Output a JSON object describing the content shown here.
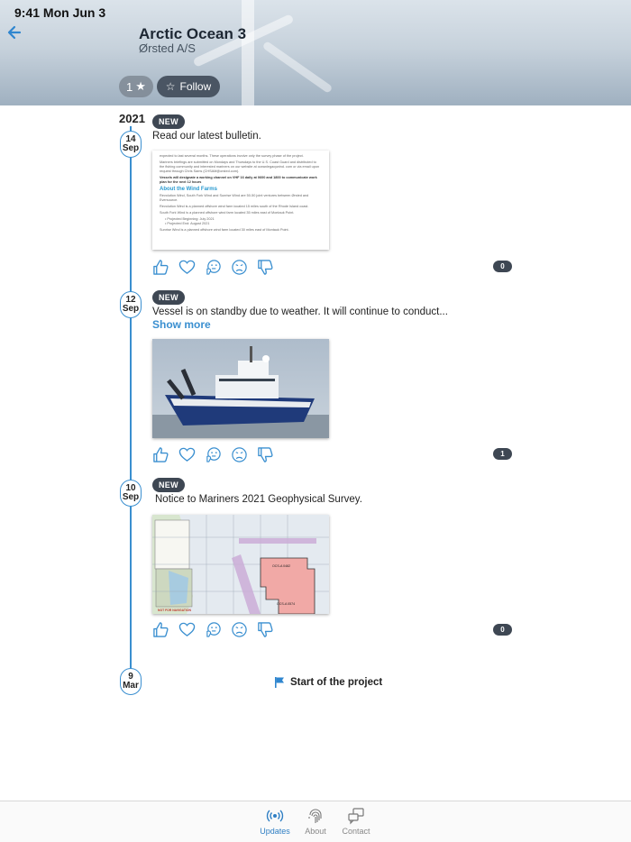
{
  "status_bar": {
    "time": "9:41  Mon Jun 3"
  },
  "header": {
    "title": "Arctic Ocean 3",
    "subtitle": "Ørsted A/S",
    "rating": "1",
    "follow_label": "Follow"
  },
  "timeline": {
    "year": "2021",
    "posts": [
      {
        "day": "14",
        "month": "Sep",
        "badge": "NEW",
        "text": "Read our latest bulletin.",
        "count": "0",
        "bulletin": {
          "line1": "expected to last several months. These operations involve only the survey phase of the project.",
          "line2": "Mariners briefings are submitted on Mondays and Thursdays to the U.S. Coast Guard and distributed to the fishing community and interested mariners on our website at oceanlegacywind. com or via email upon request through Chris Sams (CHSAM@orsted.com).",
          "line3": "Vessels will designate a working channel on VHF 16 daily at 0600 and 1800 to communicate work plan for the next 12 hours",
          "heading": "About the Wind Farms",
          "line4": "Revolution Wind, South Fork Wind and Sunrise Wind are 50-50 joint ventures between Ørsted and Eversource.",
          "line5": "Revolution Wind is a planned offshore wind farm located 15 miles south of the Rhode Island coast.",
          "line6": "South Fork Wind is a planned offshore wind farm located 35 miles east of Montauk Point.",
          "line7": "• Projected Beginning: July 2021",
          "line8": "• Projected End: August 2021",
          "line9": "Sunrise Wind is a planned offshore wind farm located 30 miles east of Montauk Point."
        }
      },
      {
        "day": "12",
        "month": "Sep",
        "badge": "NEW",
        "text": "Vessel is on standby due to weather. It will continue to conduct...",
        "show_more": "Show more",
        "count": "1"
      },
      {
        "day": "10",
        "month": "Sep",
        "badge": "NEW",
        "text": "Notice to Mariners 2021 Geophysical Survey.",
        "count": "0",
        "map_labels": {
          "area1": "OCS-A 0482",
          "area2": "OCS-A 0574",
          "warning": "NOT FOR NAVIGATION"
        }
      }
    ],
    "start": {
      "day": "9",
      "month": "Mar",
      "label": "Start of the project"
    }
  },
  "tabbar": {
    "tabs": [
      {
        "label": "Updates",
        "icon": "broadcast-icon"
      },
      {
        "label": "About",
        "icon": "fingerprint-icon"
      },
      {
        "label": "Contact",
        "icon": "chat-icon"
      }
    ]
  },
  "colors": {
    "accent": "#3a8fd0",
    "badge": "#3e4753"
  }
}
